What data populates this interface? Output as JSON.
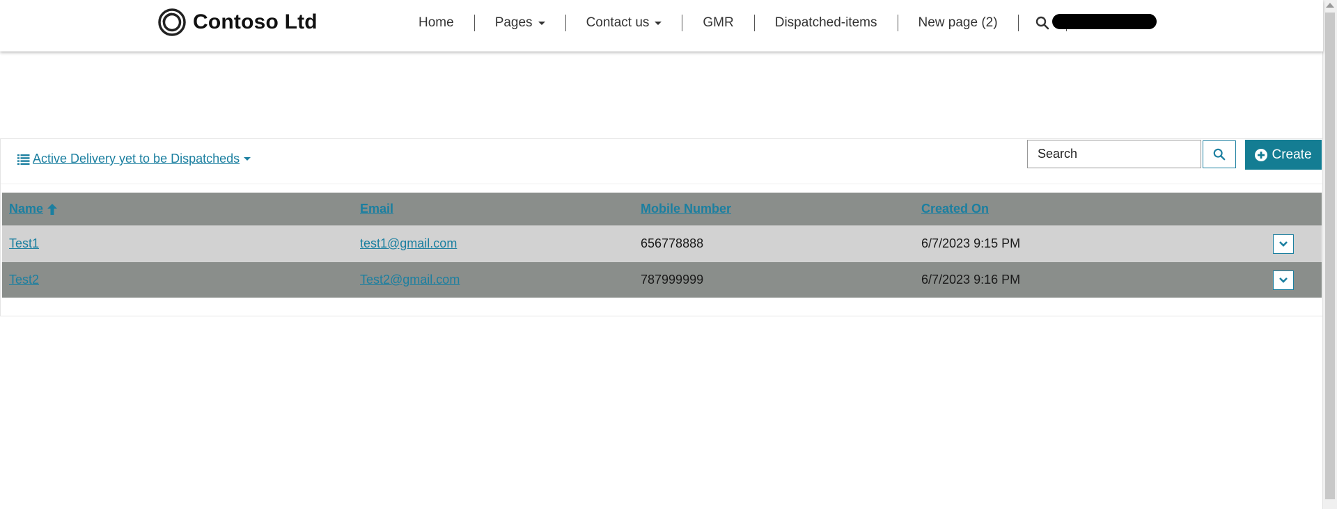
{
  "brand": {
    "name": "Contoso Ltd"
  },
  "nav": {
    "items": [
      {
        "label": "Home",
        "dropdown": false
      },
      {
        "label": "Pages",
        "dropdown": true
      },
      {
        "label": "Contact us",
        "dropdown": true
      },
      {
        "label": "GMR",
        "dropdown": false
      },
      {
        "label": "Dispatched-items",
        "dropdown": false
      },
      {
        "label": "New page (2)",
        "dropdown": false
      }
    ]
  },
  "list": {
    "view_name": "Active Delivery yet to be Dispatcheds",
    "search_placeholder": "Search",
    "create_label": "Create",
    "columns": {
      "name": "Name",
      "email": "Email",
      "mobile": "Mobile Number",
      "created": "Created On"
    },
    "rows": [
      {
        "name": "Test1",
        "email": "test1@gmail.com",
        "mobile": "656778888",
        "created": "6/7/2023 9:15 PM"
      },
      {
        "name": "Test2",
        "email": "Test2@gmail.com",
        "mobile": "787999999",
        "created": "6/7/2023 9:16 PM"
      }
    ]
  },
  "colors": {
    "accent": "#1b7fa0",
    "create_button": "#147d93",
    "header_row": "#8a8e8b",
    "alt_row": "#d2d2d2"
  },
  "icons": {
    "logo": "contoso-ring-logo",
    "search": "search-icon",
    "list": "list-icon",
    "create": "plus-circle-icon",
    "sort": "arrow-up-icon",
    "row_menu": "chevron-down-icon"
  }
}
